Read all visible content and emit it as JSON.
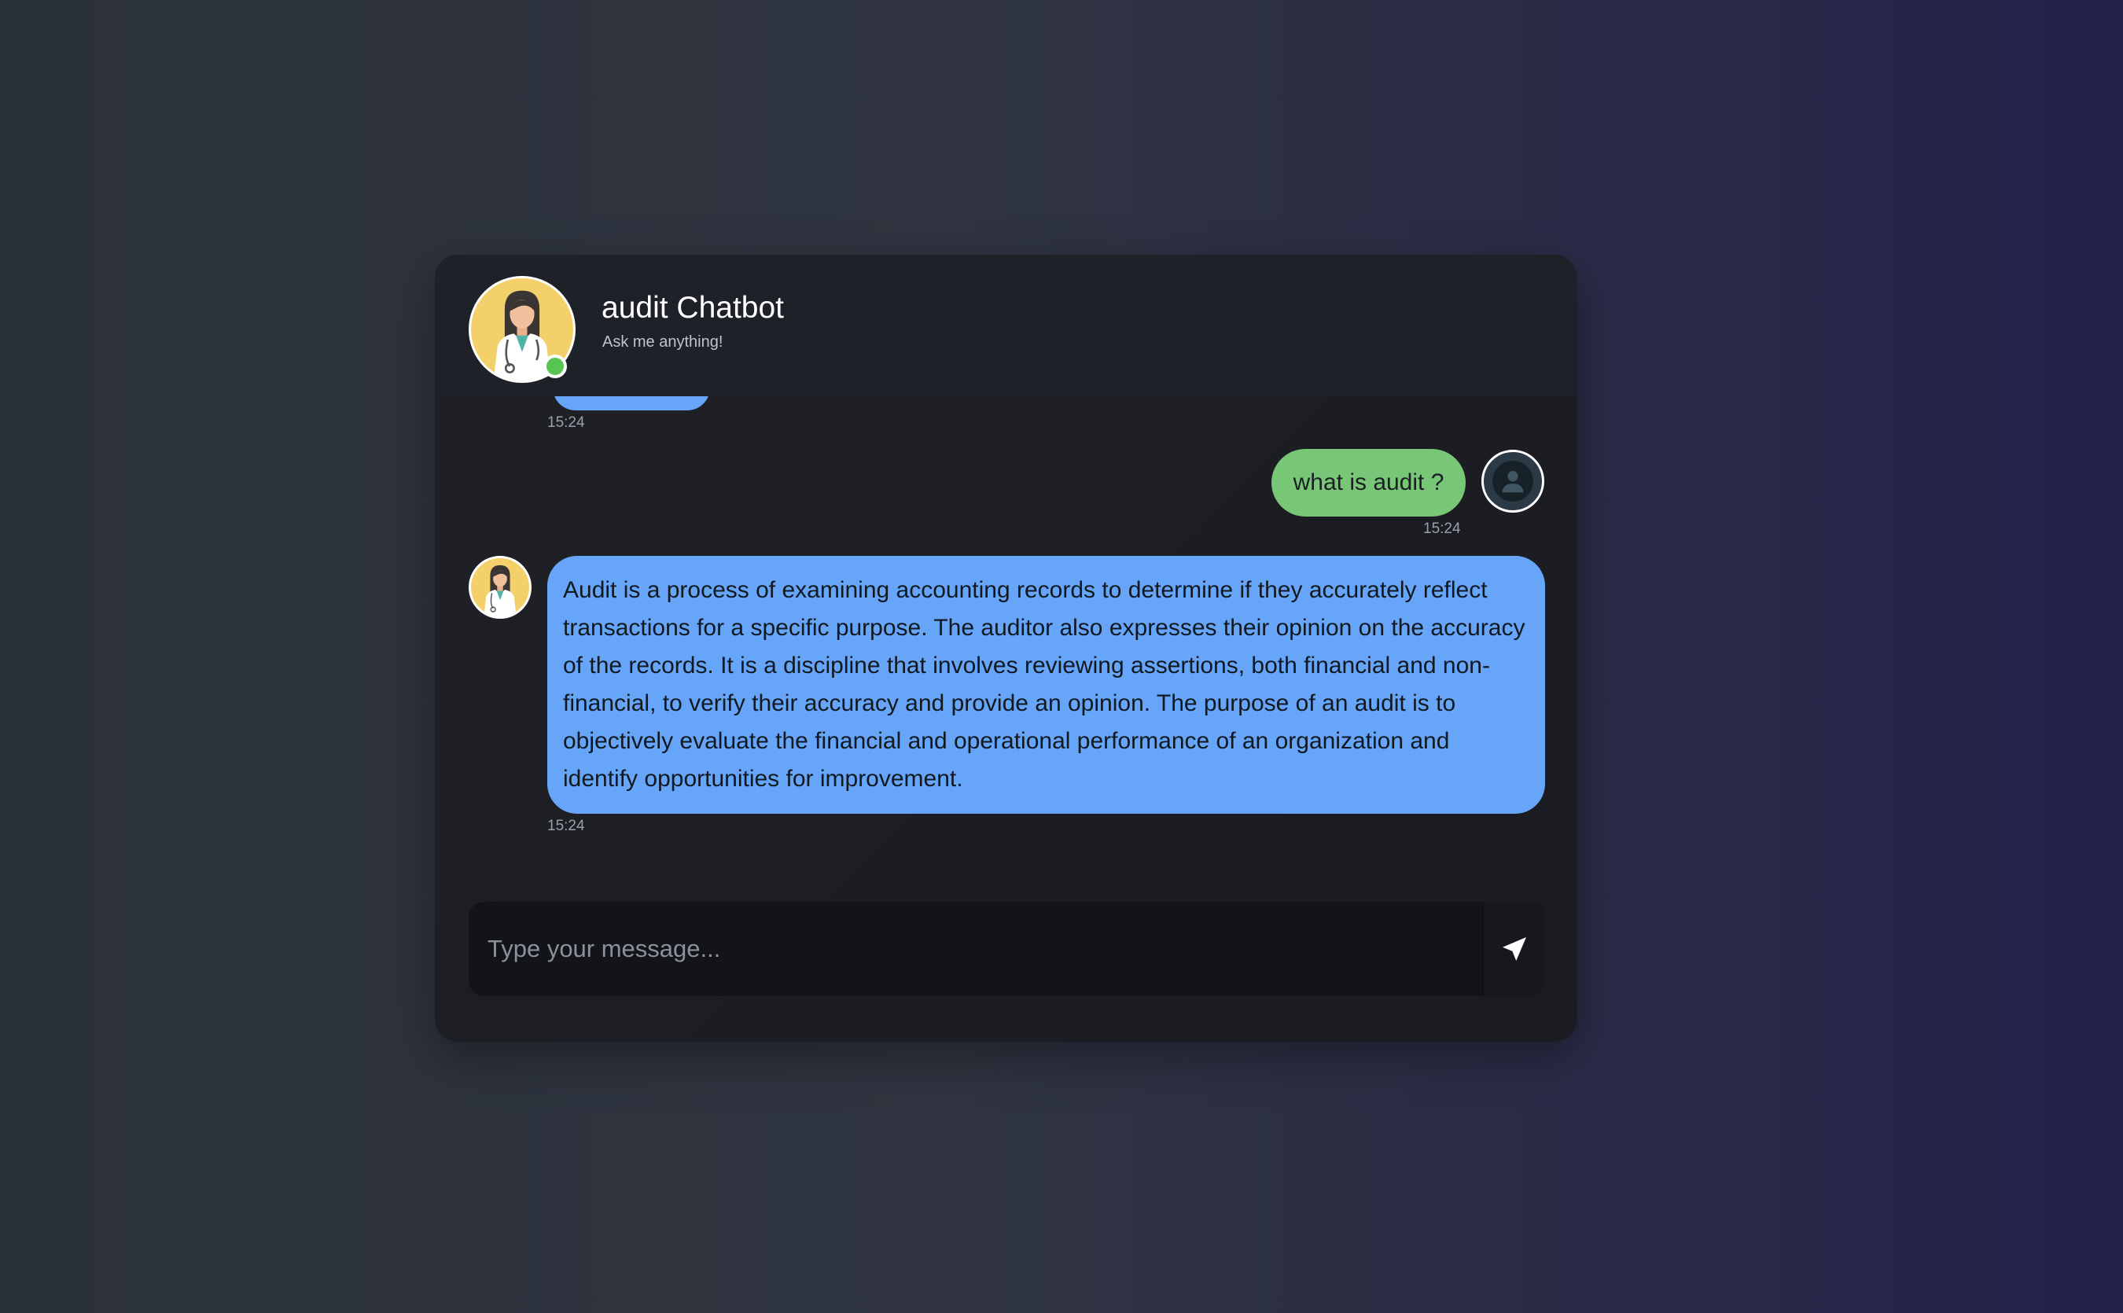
{
  "header": {
    "title": "audit Chatbot",
    "subtitle": "Ask me anything!",
    "bot_avatar_icon": "doctor-woman-avatar-icon",
    "online_status_color": "#58c452"
  },
  "messages": [
    {
      "sender": "bot",
      "text": "",
      "time": "15:24",
      "partial": true
    },
    {
      "sender": "user",
      "text": "what is audit ?",
      "time": "15:24"
    },
    {
      "sender": "bot",
      "text": "Audit is a process of examining accounting records to determine if they accurately reflect transactions for a specific purpose. The auditor also expresses their opinion on the accuracy of the records. It is a discipline that involves reviewing assertions, both financial and non-financial, to verify their accuracy and provide an opinion. The purpose of an audit is to objectively evaluate the financial and operational performance of an organization and identify opportunities for improvement.",
      "time": "15:24"
    }
  ],
  "input": {
    "placeholder": "Type your message...",
    "value": "",
    "send_icon": "send-arrow-icon"
  },
  "colors": {
    "bot_bubble": "#66a5f8",
    "user_bubble": "#78c776",
    "panel": "#1d1f25"
  }
}
